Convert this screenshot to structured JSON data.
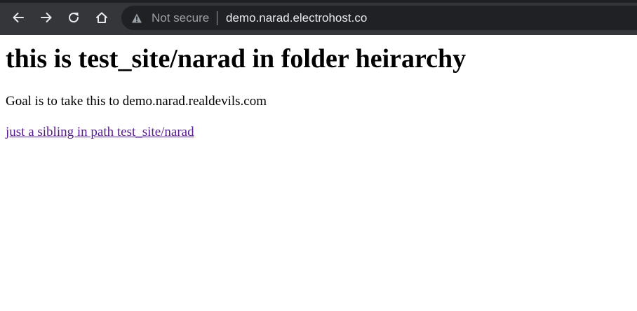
{
  "browser": {
    "security_label": "Not secure",
    "url": "demo.narad.electrohost.co",
    "icons": {
      "back": "arrow-left-icon",
      "forward": "arrow-right-icon",
      "reload": "reload-icon",
      "home": "home-icon",
      "security": "warning-triangle-icon"
    },
    "colors": {
      "toolbar": "#35363a",
      "omnibox": "#202124",
      "url_text": "#e8eaed",
      "muted_text": "#9aa0a6"
    }
  },
  "page": {
    "heading": "this is test_site/narad in folder heirarchy",
    "goal_text": "Goal is to take this to demo.narad.realdevils.com",
    "link_text": "just a sibling in path test_site/narad",
    "colors": {
      "visited_link": "#551a8b"
    }
  }
}
